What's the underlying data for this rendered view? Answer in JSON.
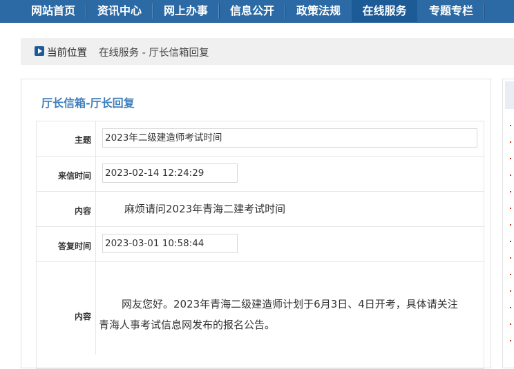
{
  "nav": {
    "items": [
      {
        "label": "网站首页"
      },
      {
        "label": "资讯中心"
      },
      {
        "label": "网上办事"
      },
      {
        "label": "信息公开"
      },
      {
        "label": "政策法规"
      },
      {
        "label": "在线服务",
        "active": true
      },
      {
        "label": "专题专栏"
      }
    ],
    "background": "#2b6aa5",
    "active_background": "#1d5b97"
  },
  "breadcrumb": {
    "label": "当前位置",
    "path": "在线服务 - 厅长信箱回复"
  },
  "panel": {
    "title": "厅长信箱-厅长回复"
  },
  "letter": {
    "subject_label": "主题",
    "subject": "2023年二级建造师考试时间",
    "sent_time_label": "来信时间",
    "sent_time": "2023-02-14 12:24:29",
    "content_label": "内容",
    "content": "麻烦请问2023年青海二建考试时间",
    "reply_time_label": "答复时间",
    "reply_time": "2023-03-01 10:58:44",
    "reply_content_label": "内容",
    "reply_line1": "网友您好。2023年青海二级建造师计划于6月3日、4日开考，具体请关注",
    "reply_line2": "青海人事考试信息网发布的报名公告。"
  }
}
